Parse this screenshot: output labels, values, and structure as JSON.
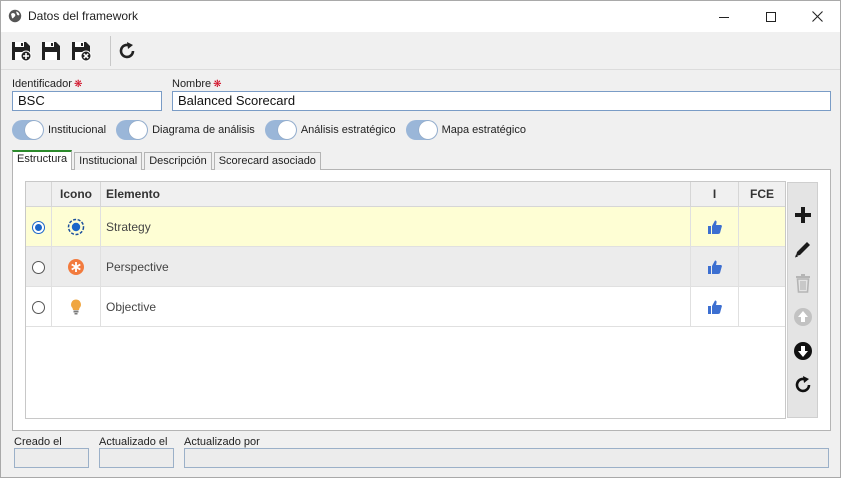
{
  "window": {
    "title": "Datos del framework"
  },
  "toolbar": {
    "buttons": [
      "save-new-icon",
      "save-icon",
      "save-close-icon",
      "refresh-icon"
    ]
  },
  "form": {
    "identificador_label": "Identificador",
    "identificador_value": "BSC",
    "nombre_label": "Nombre",
    "nombre_value": "Balanced Scorecard",
    "required_mark": "❋"
  },
  "toggles": [
    {
      "label": "Institucional",
      "on": true
    },
    {
      "label": "Diagrama de análisis",
      "on": true
    },
    {
      "label": "Análisis estratégico",
      "on": true
    },
    {
      "label": "Mapa estratégico",
      "on": true
    }
  ],
  "tabs": [
    {
      "label": "Estructura",
      "active": true
    },
    {
      "label": "Institucional",
      "active": false
    },
    {
      "label": "Descripción",
      "active": false
    },
    {
      "label": "Scorecard asociado",
      "active": false
    }
  ],
  "grid": {
    "headers": {
      "icono": "Icono",
      "elemento": "Elemento",
      "i": "I",
      "fce": "FCE"
    },
    "rows": [
      {
        "selected": true,
        "icon": "strategy-target-icon",
        "elemento": "Strategy",
        "i_icon": "thumbs-up-icon",
        "fce": ""
      },
      {
        "selected": false,
        "icon": "perspective-asterisk-icon",
        "elemento": "Perspective",
        "i_icon": "thumbs-up-icon",
        "fce": ""
      },
      {
        "selected": false,
        "icon": "objective-bulb-icon",
        "elemento": "Objective",
        "i_icon": "thumbs-up-icon",
        "fce": ""
      }
    ]
  },
  "side_buttons": [
    "add-icon",
    "edit-icon",
    "delete-icon",
    "move-up-icon",
    "move-down-icon",
    "refresh-icon"
  ],
  "footer": {
    "creado_label": "Creado el",
    "creado_value": "",
    "actualizado_label": "Actualizado el",
    "actualizado_value": "",
    "actualizado_por_label": "Actualizado por",
    "actualizado_por_value": ""
  },
  "colors": {
    "selected_row": "#fefed4",
    "alt_row": "#ececec",
    "accent_blue": "#1b66c9",
    "toggle_track": "#9ab6d8",
    "perspective_orange": "#f27b3e",
    "objective_gold": "#f0a640"
  }
}
